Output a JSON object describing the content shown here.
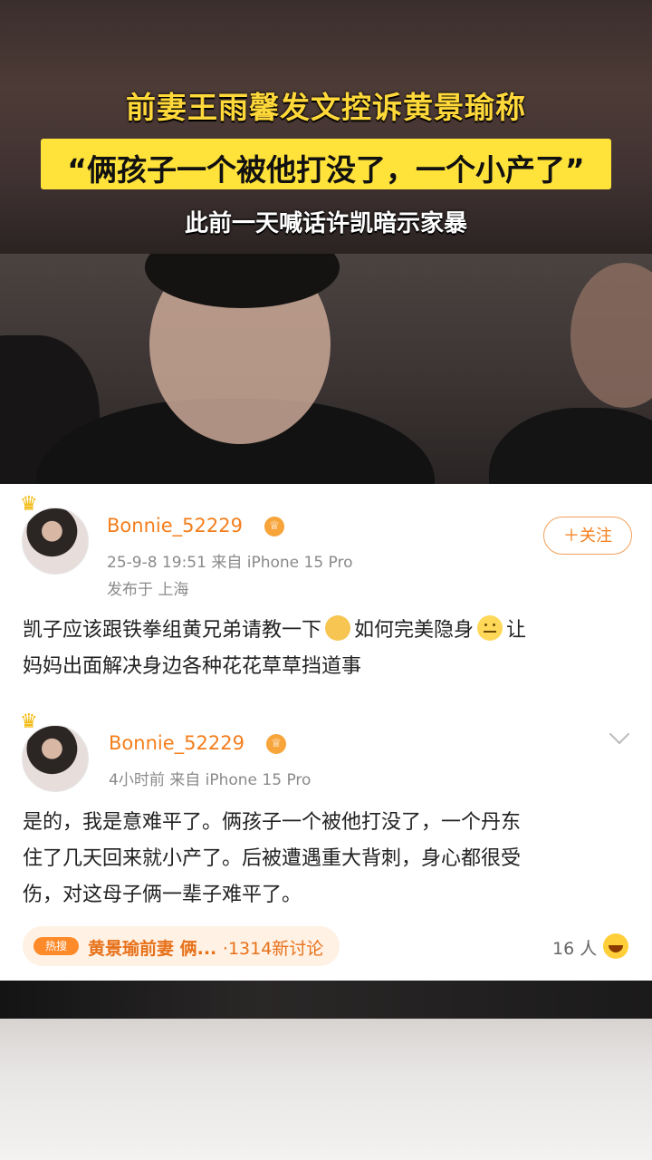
{
  "header": {
    "headline_1": "前妻王雨馨发文控诉黄景瑜称",
    "quote": "“俩孩子一个被他打没了，一个小产了”",
    "headline_3": "此前一天喊话许凯暗示家暴"
  },
  "post_1": {
    "username": "Bonnie_52229",
    "meta_line": "25-9-8 19:51  来自 iPhone 15 Pro",
    "location": "发布于 上海",
    "follow_label": "＋关注",
    "text_part1": "凯子应该跟铁拳组黄兄弟请教一下",
    "text_part2": "如何完美隐身",
    "text_part3": "让",
    "text_line2": "妈妈出面解决身边各种花花草草挡道事",
    "emoji_1": "pray-icon",
    "emoji_2": "neutral-face-icon"
  },
  "post_2": {
    "username": "Bonnie_52229",
    "meta_line": "4小时前  来自 iPhone 15 Pro",
    "line_1": "是的，我是意难平了。俩孩子一个被他打没了，一个丹东",
    "line_2": "住了几天回来就小产了。后被遭遇重大背刺，身心都很受",
    "line_3": "伤，对这母子俩一辈子难平了。"
  },
  "topic": {
    "hot_label": "热搜",
    "title": "黄景瑜前妻 俩...",
    "count": "·1314新讨论"
  },
  "footer": {
    "people": "16 人"
  },
  "colors": {
    "accent_orange": "#f47e1c",
    "headline_yellow": "#ffd83a",
    "quote_bg": "#ffe23a"
  }
}
